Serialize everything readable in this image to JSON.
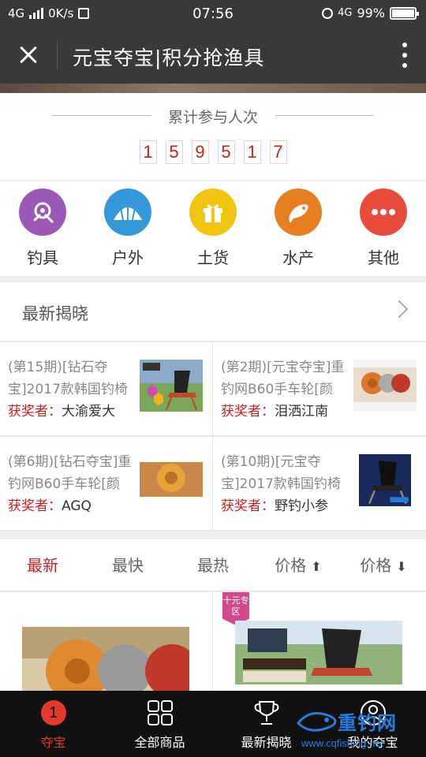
{
  "status_bar": {
    "network": "4G",
    "speed": "0K/s",
    "time": "07:56",
    "network_right": "4G",
    "battery": "99%"
  },
  "nav": {
    "title": "元宝夺宝|积分抢渔具"
  },
  "counter": {
    "title": "累计参与人次",
    "digits": [
      "1",
      "5",
      "9",
      "5",
      "1",
      "7"
    ]
  },
  "categories": [
    {
      "label": "钓具",
      "icon": "fishing-reel-icon",
      "color": "#9b59b6"
    },
    {
      "label": "户外",
      "icon": "tent-icon",
      "color": "#3498db"
    },
    {
      "label": "土货",
      "icon": "gift-icon",
      "color": "#f1c40f"
    },
    {
      "label": "水产",
      "icon": "fish-icon",
      "color": "#e67e22"
    },
    {
      "label": "其他",
      "icon": "more-dots-icon",
      "color": "#e74c3c"
    }
  ],
  "latest": {
    "title": "最新揭晓",
    "winner_label": "获奖者：",
    "items": [
      {
        "title": "(第15期)[钻石夺宝]2017款韩国钓椅",
        "winner": "大渝爱大"
      },
      {
        "title": "(第2期)[元宝夺宝]重钓网B60手车轮[颜",
        "winner": "泪洒江南"
      },
      {
        "title": "(第6期)[钻石夺宝]重钓网B60手车轮[颜",
        "winner": "AGQ"
      },
      {
        "title": "(第10期)[元宝夺宝]2017款韩国钓椅",
        "winner": "野钓小参"
      }
    ]
  },
  "sort_tabs": [
    "最新",
    "最快",
    "最热",
    "价格",
    "价格"
  ],
  "products": {
    "badge": "十元专区"
  },
  "bottom_nav": [
    {
      "label": "夺宝",
      "badge": "1"
    },
    {
      "label": "全部商品"
    },
    {
      "label": "最新揭晓"
    },
    {
      "label": "我的夺宝"
    }
  ],
  "watermark": {
    "brand": "重钓网",
    "url": "www.cqfishing.net"
  },
  "colors": {
    "accent": "#c81e1e",
    "header": "#3a3a3a",
    "tab_bar": "#111111"
  }
}
